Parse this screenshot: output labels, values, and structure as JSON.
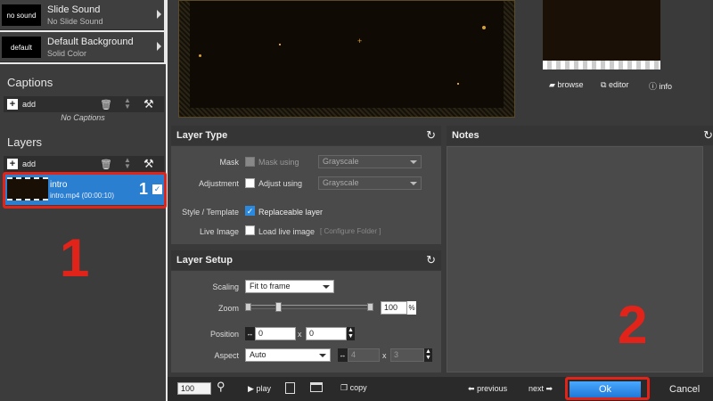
{
  "sidebar": {
    "slide_sound": {
      "thumb": "no sound",
      "title": "Slide Sound",
      "subtitle": "No Slide Sound"
    },
    "default_background": {
      "thumb": "default",
      "title": "Default Background",
      "subtitle": "Solid Color"
    },
    "captions": {
      "title": "Captions",
      "add_label": "add",
      "empty_text": "No Captions"
    },
    "layers": {
      "title": "Layers",
      "add_label": "add",
      "items": [
        {
          "name": "intro",
          "detail": "intro.mp4 (00:00:10)",
          "index": "1",
          "checked": true
        }
      ]
    }
  },
  "preview": {
    "browse": "browse",
    "editor": "editor",
    "info": "info"
  },
  "layer_type": {
    "title": "Layer Type",
    "mask_label": "Mask",
    "mask_check": "Mask using",
    "mask_select": "Grayscale",
    "adjustment_label": "Adjustment",
    "adjustment_check": "Adjust using",
    "adjustment_select": "Grayscale",
    "style_label": "Style / Template",
    "style_check": "Replaceable layer",
    "live_label": "Live Image",
    "live_check": "Load live image",
    "configure_folder": "[ Configure Folder ]"
  },
  "layer_setup": {
    "title": "Layer Setup",
    "scaling_label": "Scaling",
    "scaling_value": "Fit to frame",
    "zoom_label": "Zoom",
    "zoom_value": "100",
    "zoom_unit": "%",
    "position_label": "Position",
    "position_x": "0",
    "position_y": "0",
    "x_sep": "x",
    "aspect_label": "Aspect",
    "aspect_value": "Auto",
    "aspect_x": "4",
    "aspect_y": "3"
  },
  "notes": {
    "title": "Notes"
  },
  "bottom": {
    "zoom_value": "100",
    "play": "play",
    "copy": "copy",
    "previous": "previous",
    "next": "next",
    "ok": "Ok",
    "cancel": "Cancel"
  },
  "annotations": {
    "marker1": "1",
    "marker2": "2",
    "color": "#e2231a"
  }
}
